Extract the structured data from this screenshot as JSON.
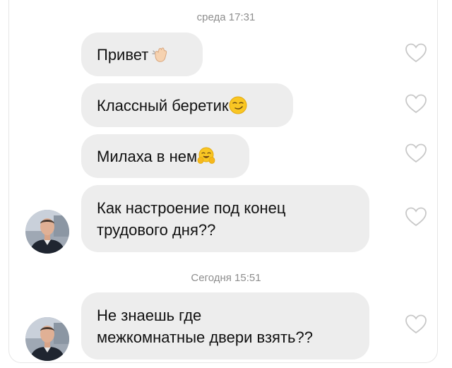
{
  "timestamps": {
    "first": "среда 17:31",
    "second": "Сегодня 15:51"
  },
  "messages": [
    {
      "text": "Привет",
      "emoji": "waving-hand-emoji",
      "sender": "self"
    },
    {
      "text": "Классный беретик",
      "emoji": "smirking-face-emoji",
      "sender": "self"
    },
    {
      "text": "Милаха в нем",
      "emoji": "hugging-face-emoji",
      "sender": "self"
    },
    {
      "text": "Как настроение под конец\nтрудового дня??",
      "emoji": "",
      "sender": "self"
    },
    {
      "text": "Не знаешь где\nмежкомнатные двери взять??",
      "emoji": "",
      "sender": "self"
    }
  ],
  "icons": {
    "like": "heart-outline-icon",
    "avatar": "user-avatar"
  },
  "colors": {
    "bubble": "#ededed",
    "timestamp": "#8e8e8e",
    "heart_stroke": "#c8c8c8"
  }
}
